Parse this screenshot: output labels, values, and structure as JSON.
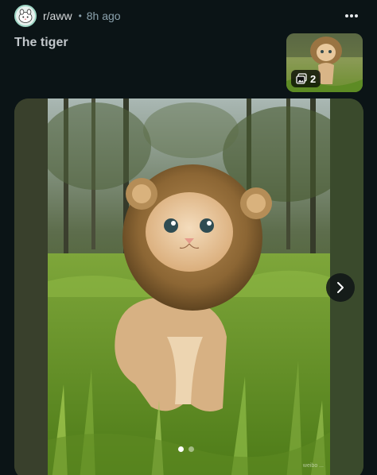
{
  "header": {
    "subreddit": "r/aww",
    "separator": "•",
    "time_ago": "8h ago",
    "more_icon": "more-horizontal-icon"
  },
  "post": {
    "title": "The tiger"
  },
  "thumbnail": {
    "gallery_icon": "gallery-icon",
    "count": "2"
  },
  "gallery": {
    "next_icon": "chevron-right-icon",
    "pages": 2,
    "current_page": 1,
    "watermark": "weibo ..."
  },
  "colors": {
    "background": "#0b1416",
    "meta": "#8ba2ad",
    "accent_avatar": "#9fd7c6"
  }
}
